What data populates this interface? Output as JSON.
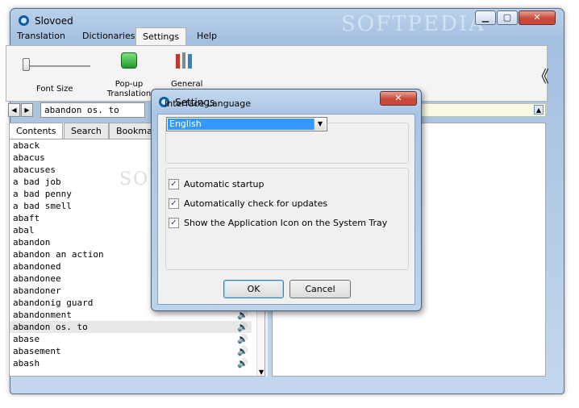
{
  "window": {
    "title": "Slovoed",
    "watermark": "SOFTPEDIA",
    "min_glyph": "▁",
    "max_glyph": "▢",
    "close_glyph": "✕"
  },
  "menu": {
    "tabs": [
      "Translation",
      "Dictionaries",
      "Settings",
      "Help"
    ],
    "active": "Settings"
  },
  "ribbon": {
    "font_size_label": "Font Size",
    "popup_label": "Pop-up Translation",
    "general_label": "General",
    "collapse_glyph": "《"
  },
  "search": {
    "value": "abandon os. to",
    "back_glyph": "◀",
    "forward_glyph": "▶"
  },
  "left_tabs": [
    "Contents",
    "Search",
    "Bookmarks"
  ],
  "words": [
    {
      "text": "aback",
      "speaker": false
    },
    {
      "text": "abacus",
      "speaker": false
    },
    {
      "text": "abacuses",
      "speaker": false
    },
    {
      "text": "a bad job",
      "speaker": false
    },
    {
      "text": "a bad penny",
      "speaker": false
    },
    {
      "text": "a bad smell",
      "speaker": false
    },
    {
      "text": "abaft",
      "speaker": false
    },
    {
      "text": "abal",
      "speaker": false
    },
    {
      "text": "abandon",
      "speaker": false
    },
    {
      "text": "abandon an action",
      "speaker": false
    },
    {
      "text": "abandoned",
      "speaker": false
    },
    {
      "text": "abandonee",
      "speaker": false
    },
    {
      "text": "abandoner",
      "speaker": false
    },
    {
      "text": "abandonig guard",
      "speaker": false
    },
    {
      "text": "abandonment",
      "speaker": true
    },
    {
      "text": "abandon os. to",
      "speaker": true,
      "selected": true
    },
    {
      "text": "abase",
      "speaker": true
    },
    {
      "text": "abasement",
      "speaker": true
    },
    {
      "text": "abash",
      "speaker": true
    }
  ],
  "speaker_glyph": "🔊",
  "dialog": {
    "title": "Settings",
    "close_glyph": "✕",
    "language_group_label": "Interface Language",
    "language_value": "English",
    "dropdown_glyph": "▼",
    "check_glyph": "✓",
    "options": [
      {
        "label": "Automatic startup",
        "checked": true
      },
      {
        "label": "Automatically check for updates",
        "checked": true
      },
      {
        "label": "Show the Application Icon on the System Tray",
        "checked": true
      }
    ],
    "ok_label": "OK",
    "cancel_label": "Cancel"
  },
  "colors": {
    "accent": "#3399ff",
    "window_frame": "#a4c0e0",
    "close_red": "#c8483a"
  }
}
